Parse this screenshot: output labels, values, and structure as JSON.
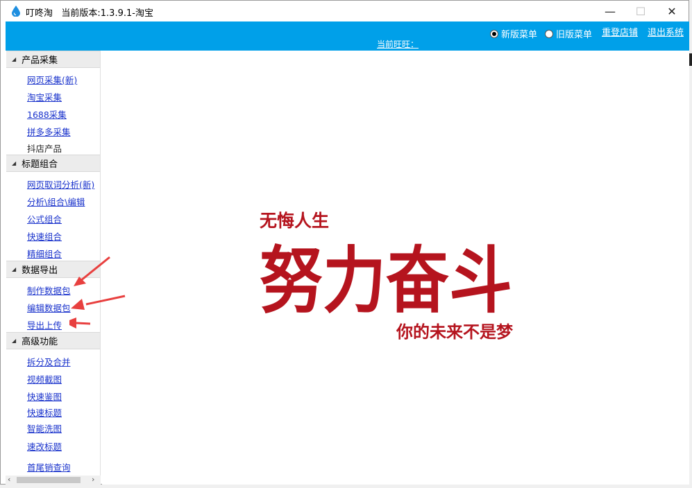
{
  "window": {
    "title": "叮咚淘   当前版本:1.3.9.1-淘宝",
    "controls": {
      "minimize": "—",
      "maximize": "☐",
      "close": "✕"
    }
  },
  "topbar": {
    "radio_new": "新版菜单",
    "radio_old": "旧版菜单",
    "relogin": "重登店铺",
    "logout": "退出系统",
    "current_wangwang": "当前旺旺："
  },
  "sidebar": {
    "groups": [
      {
        "title": "产品采集",
        "items": [
          "网页采集(新)",
          "淘宝采集",
          "1688采集",
          "拼多多采集",
          "抖店产品"
        ]
      },
      {
        "title": "标题组合",
        "items": [
          "网页取词分析(新)",
          "分析\\组合\\编辑",
          "公式组合",
          "快速组合",
          "精细组合"
        ]
      },
      {
        "title": "数据导出",
        "items": [
          "制作数据包",
          "编辑数据包",
          "导出上传"
        ]
      },
      {
        "title": "高级功能",
        "items": [
          "拆分及合并",
          "视频截图",
          "快速鉴图",
          "快速标题",
          "智能洗图",
          "速改标题",
          "首尾销查询"
        ]
      }
    ]
  },
  "poster": {
    "top": "无悔人生",
    "main": "努力奋斗",
    "bottom": "你的未来不是梦"
  },
  "colors": {
    "accent": "#00a0e9",
    "poster_red": "#b5141e",
    "arrow": "#e8403f",
    "link": "#1a33cc"
  }
}
